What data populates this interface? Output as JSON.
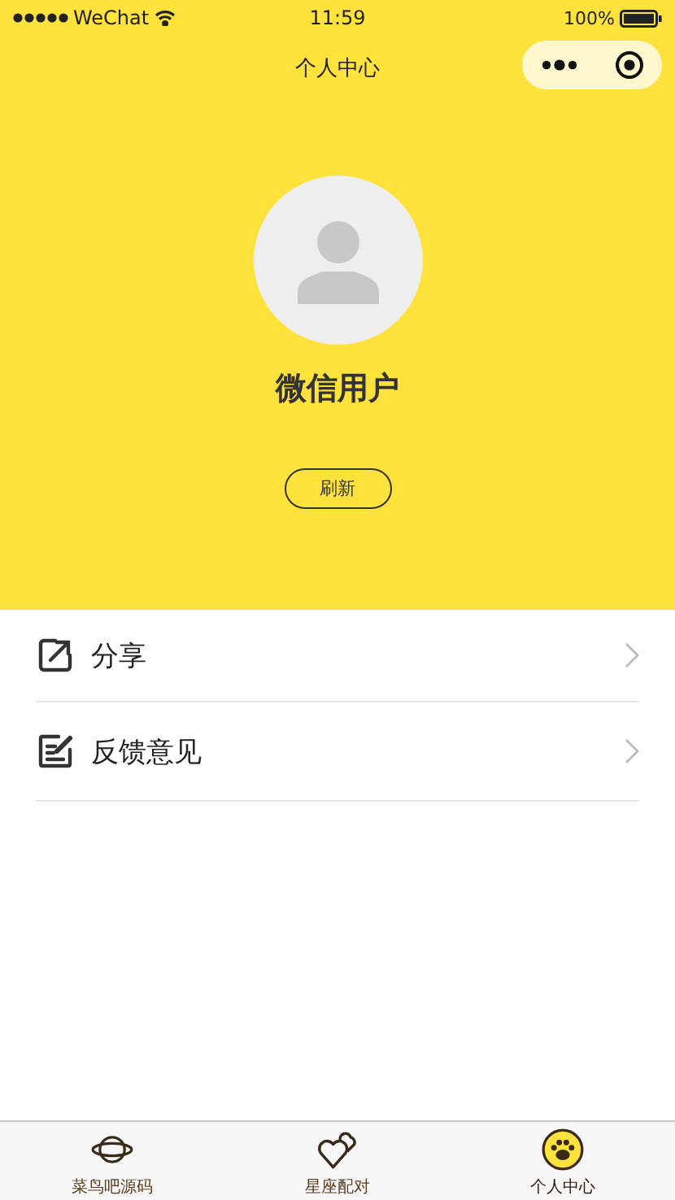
{
  "status_bar": {
    "carrier": "WeChat",
    "time": "11:59",
    "battery": "100%"
  },
  "nav_bar": {
    "title": "个人中心"
  },
  "profile": {
    "name": "微信用户",
    "refresh_button": "刷新"
  },
  "menu": [
    {
      "kind": "share",
      "label": "分享"
    },
    {
      "kind": "feedback",
      "label": "反馈意见"
    }
  ],
  "tab_bar": [
    {
      "kind": "planet",
      "label": "菜鸟吧源码",
      "selected": false
    },
    {
      "kind": "hearts",
      "label": "星座配对",
      "selected": false
    },
    {
      "kind": "paw",
      "label": "个人中心",
      "selected": true
    }
  ]
}
